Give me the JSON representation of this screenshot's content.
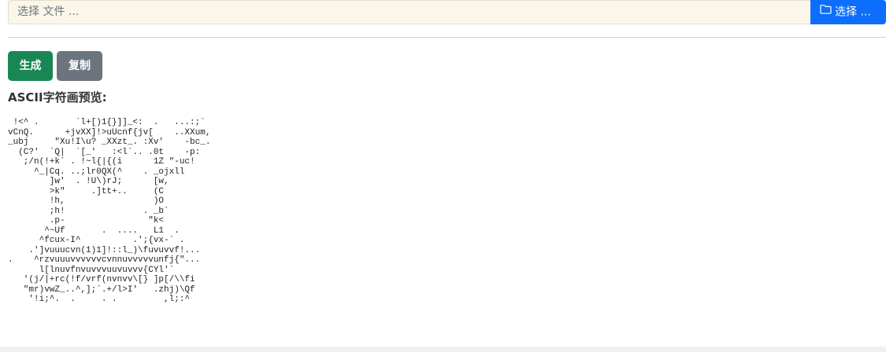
{
  "file_picker": {
    "placeholder": "选择 文件 ...",
    "button_label": "选择 ...",
    "button_icon": "folder-icon"
  },
  "actions": {
    "generate_label": "生成",
    "copy_label": "复制"
  },
  "preview": {
    "heading": "ASCII字符画预览:",
    "ascii_art": " !<^ .       `l+[)1{}]]_<:  .   ...:;`\nvCnQ.      +jvXX]!>uUcnf{jv[    ..XXum,\n_ubj     \"Xu!I\\u? _XXzt_. :Xv'    -bc_.\n  (C?'  `Q|  `[_'   :<l`.. .0t    -p:\n   ;/n(!+k` . !~l{|{(i      1Z \"-uc!\n     ^_|Cq. ..;lr0QX(^    . _ojxll\n        ]w'  . !U\\)rJ;      [w,\n        >k\"     .]tt+..     (C\n        !h,                 )O\n        ;h!               . _b`\n        .p-                \"k<\n       ^~Uf       .  ....   L1  .\n      ^fcux-I^          .';{vx-` .\n    .']vuuucvn(1)1]!::l_)\\fuvuvvf!...\n.    ^rzvuuuvvvvvvcvnnuvvvvvunfj{\"...\n      l[lnuvfnvuvvvuuvuvvv{CYl'`\n   '(j/|+rc(!f/vrf(nvnvv\\[} ]p[/\\\\fi\n   \"mr)vwZ_..^,];`.+/l>I'   .zhj)\\Qf\n    '!i;^.  .     . .         ,l;:^"
  },
  "colors": {
    "primary": "#0d6efd",
    "success": "#198754",
    "secondary": "#6c757d",
    "input_background": "#fbf6ea"
  }
}
